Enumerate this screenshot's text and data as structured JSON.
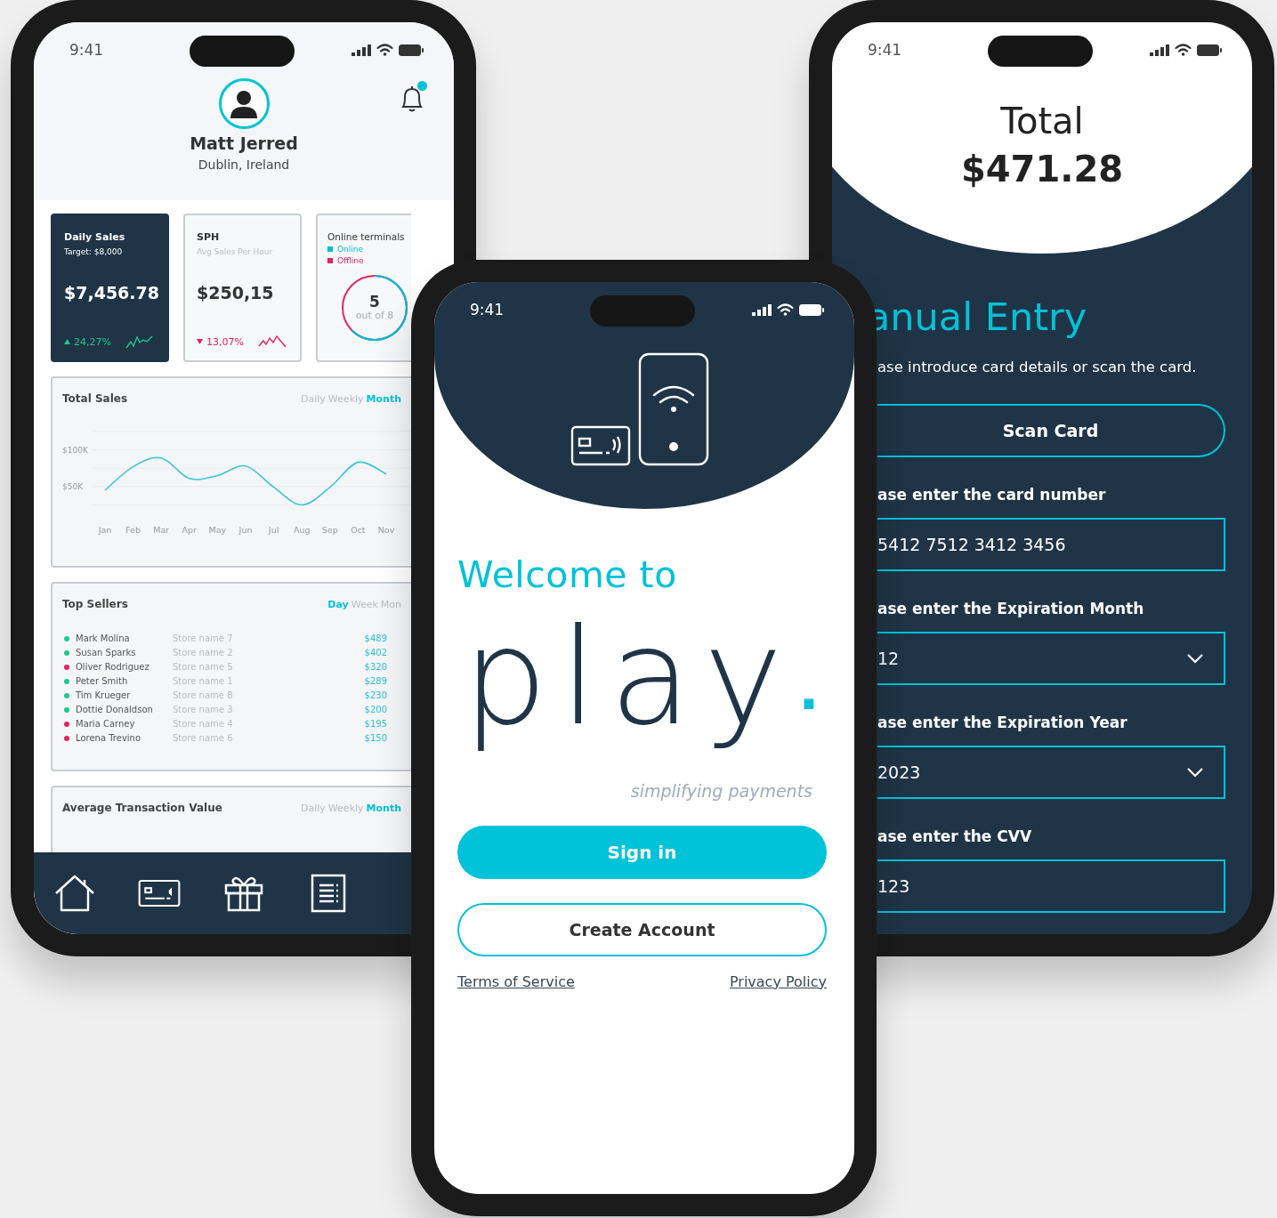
{
  "dashboard_screen": {
    "status_time": "9:41",
    "profile": {
      "name": "Matt Jerred",
      "location": "Dublin, Ireland",
      "notification_unread": true
    },
    "stats": [
      {
        "kind": "sales",
        "selected": true,
        "title": "Daily Sales",
        "subtitle": "Target: $8,000",
        "value": "$7,456.78",
        "change": "24,27%",
        "trend_up": true
      },
      {
        "kind": "sales",
        "selected": false,
        "title": "SPH",
        "subtitle": "Avg Sales Per Hour",
        "value": "$250,15",
        "change": "13,07%",
        "trend_up": false
      },
      {
        "kind": "terminals",
        "selected": false,
        "title": "Online terminals",
        "legend": [
          {
            "label": "Online",
            "color": "#00bcd4"
          },
          {
            "label": "Offline",
            "color": "#e0245e"
          }
        ],
        "count": "5",
        "total": "out of 8"
      }
    ],
    "total_sales": {
      "title": "Total Sales",
      "periods": [
        {
          "label": "Daily",
          "selected": false
        },
        {
          "label": "Weekly",
          "selected": false
        },
        {
          "label": "Month",
          "selected": true
        }
      ],
      "chart_data": {
        "type": "line",
        "categories": [
          "Jan",
          "Feb",
          "Mar",
          "Apr",
          "May",
          "Jun",
          "Jul",
          "Aug",
          "Sep",
          "Oct",
          "Nov"
        ],
        "ylim": [
          25000,
          125000
        ],
        "yticks": [
          {
            "value": 50000,
            "label": "$50K"
          },
          {
            "value": 100000,
            "label": "$100K"
          }
        ],
        "series": [
          {
            "color": "#3cc6d6",
            "values": [
              45000,
              77000,
              89000,
              61000,
              65000,
              78000,
              49000,
              25000,
              49000,
              83000,
              67000
            ]
          }
        ]
      }
    },
    "top_sellers": {
      "title": "Top Sellers",
      "periods": [
        {
          "label": "Day",
          "selected": true
        },
        {
          "label": "Week",
          "selected": false
        },
        {
          "label": "Mon",
          "selected": false
        }
      ],
      "rows": [
        {
          "name": "Mark Molina",
          "store": "Store name 7",
          "amount": "$489",
          "color": "#1ec98b"
        },
        {
          "name": "Susan Sparks",
          "store": "Store name 2",
          "amount": "$402",
          "color": "#1ec98b"
        },
        {
          "name": "Oliver Rodriguez",
          "store": "Store name 5",
          "amount": "$320",
          "color": "#e0245e"
        },
        {
          "name": "Peter Smith",
          "store": "Store name 1",
          "amount": "$289",
          "color": "#1ec98b"
        },
        {
          "name": "Tim Krueger",
          "store": "Store name 8",
          "amount": "$230",
          "color": "#1ec98b"
        },
        {
          "name": "Dottie Donaldson",
          "store": "Store name 3",
          "amount": "$200",
          "color": "#1ec98b"
        },
        {
          "name": "Maria Carney",
          "store": "Store name 4",
          "amount": "$195",
          "color": "#e0245e"
        },
        {
          "name": "Lorena Trevino",
          "store": "Store name 6",
          "amount": "$150",
          "color": "#e0245e"
        }
      ]
    },
    "avg_transaction": {
      "title": "Average Transaction Value",
      "periods": [
        {
          "label": "Daily",
          "selected": false
        },
        {
          "label": "Weekly",
          "selected": false
        },
        {
          "label": "Month",
          "selected": true
        }
      ]
    }
  },
  "sign_in_screen": {
    "status_time": "9:41",
    "welcome": "Welcome to",
    "logo_word": "play",
    "logo_dot": ".",
    "tagline": "simplifying payments",
    "primary_button": "Sign in",
    "secondary_button": "Create Account",
    "links": [
      "Terms of Service",
      "Privacy Policy"
    ]
  },
  "payment_screen": {
    "status_time": "9:41",
    "total_label": "Total",
    "total_amount": "$471.28",
    "heading": "anual Entry",
    "intro": "ase introduce card details or scan the card.",
    "scan_button": "Scan Card",
    "fields": [
      {
        "kind": "text",
        "label": "ase enter the card number",
        "value": "5412 7512 3412 3456"
      },
      {
        "kind": "select",
        "label": "ase enter the Expiration Month",
        "value": "12"
      },
      {
        "kind": "select",
        "label": "ase enter the Expiration Year",
        "value": "2023"
      },
      {
        "kind": "text",
        "label": "ase enter the CVV",
        "value": "123"
      }
    ]
  }
}
